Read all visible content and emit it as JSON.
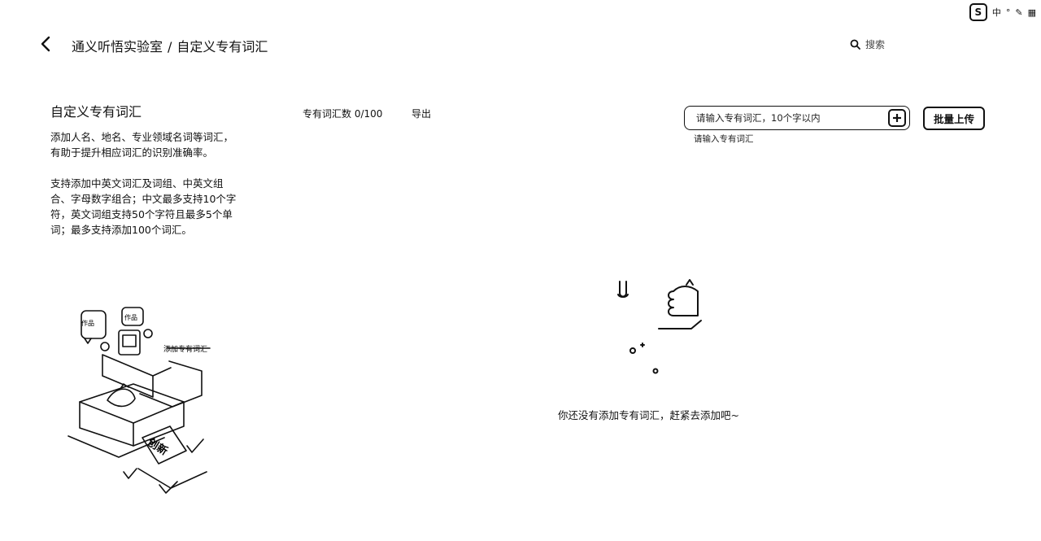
{
  "ime": {
    "logo": "S",
    "label": "中",
    "glyphs": [
      "°",
      "✎",
      "▦"
    ]
  },
  "header": {
    "app_name": "通义听悟实验室",
    "separator": "/",
    "page_name": "自定义专有词汇",
    "search_label": "搜索"
  },
  "sidebar": {
    "title": "自定义专有词汇",
    "description_1": "添加人名、地名、专业领域名词等词汇，有助于提升相应词汇的识别准确率。",
    "description_2": "支持添加中英文词汇及词组、中英文组合、字母数字组合；中文最多支持10个字符，英文词组支持50个字符且最多5个单词；最多支持添加100个词汇。",
    "illustration_labels": {
      "box_label": "添加专有词汇",
      "tag_label": "创新",
      "card_label": "作品"
    }
  },
  "toolbar": {
    "count_label": "专有词汇数 0/100",
    "export_label": "导出",
    "input_placeholder": "请输入专有词汇，10个字以内",
    "input_hint": "请输入专有词汇",
    "batch_upload_label": "批量上传"
  },
  "empty_state": {
    "message": "你还没有添加专有词汇，赶紧去添加吧~"
  }
}
